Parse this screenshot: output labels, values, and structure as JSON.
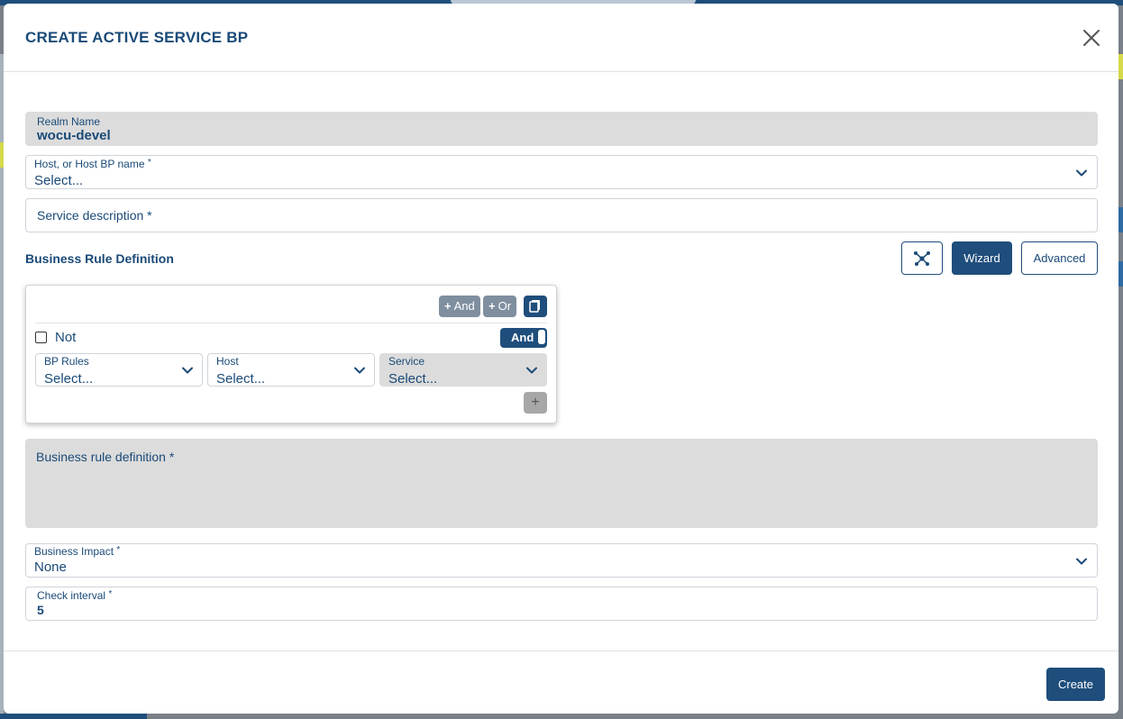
{
  "modal": {
    "title": "CREATE ACTIVE SERVICE BP"
  },
  "form": {
    "realm": {
      "label": "Realm Name",
      "value": "wocu-devel"
    },
    "host": {
      "label": "Host, or Host BP name",
      "required": "*",
      "placeholder": "Select..."
    },
    "service_description": {
      "label": "Service description",
      "required": "*"
    },
    "business_rule_section": {
      "title": "Business Rule Definition",
      "graph_icon": "network-graph-icon",
      "wizard_label": "Wizard",
      "advanced_label": "Advanced"
    },
    "rule_group": {
      "and_label": "And",
      "or_label": "Or",
      "plus_glyph": "+",
      "copy_icon": "copy-icon",
      "not_label": "Not",
      "operator_toggle": "And",
      "selects": [
        {
          "label": "BP Rules",
          "placeholder": "Select..."
        },
        {
          "label": "Host",
          "placeholder": "Select..."
        },
        {
          "label": "Service",
          "placeholder": "Select..."
        }
      ],
      "add_row_glyph": "+"
    },
    "business_rule_definition": {
      "label": "Business rule definition",
      "required": "*"
    },
    "business_impact": {
      "label": "Business Impact",
      "required": "*",
      "value": "None"
    },
    "check_interval": {
      "label": "Check interval",
      "required": "*",
      "value": "5"
    }
  },
  "footer": {
    "create_label": "Create"
  },
  "colors": {
    "primary": "#1f4e7c",
    "text": "#1a4a78",
    "disabled_bg": "#dcdcdc",
    "muted_button": "#7f8f9f"
  }
}
